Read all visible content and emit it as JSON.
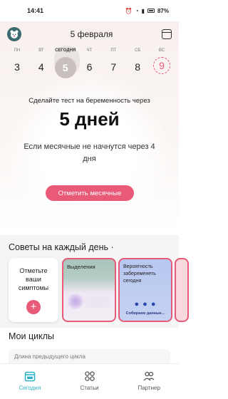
{
  "status_bar": {
    "time": "14:41",
    "battery": "87%"
  },
  "header": {
    "title": "5 февраля"
  },
  "week": [
    {
      "label": "ПН",
      "num": "3"
    },
    {
      "label": "ВТ",
      "num": "4"
    },
    {
      "label": "СЕГОДНЯ",
      "num": "5"
    },
    {
      "label": "ЧТ",
      "num": "6"
    },
    {
      "label": "ПТ",
      "num": "7"
    },
    {
      "label": "СБ",
      "num": "8"
    },
    {
      "label": "ВС",
      "num": "9"
    }
  ],
  "prediction": {
    "label": "Сделайте тест на беременность через",
    "value": "5 дней",
    "sub": "Если месячные не начнутся через 4 дня"
  },
  "mark_button": "Отметить месячные",
  "tips": {
    "title": "Советы на каждый день ·",
    "cards": [
      {
        "text": "Отметьте ваши симптомы"
      },
      {
        "text": "Выделения"
      },
      {
        "text": "Вероятность забеременеть сегодня",
        "footer": "Собираем данные..."
      }
    ]
  },
  "cycles": {
    "title": "Мои циклы",
    "row": "Длина предыдущего цикла"
  },
  "tabbar": [
    {
      "label": "Сегодня",
      "icon": "calendar-icon"
    },
    {
      "label": "Статьи",
      "icon": "grid-icon"
    },
    {
      "label": "Партнер",
      "icon": "partner-icon"
    }
  ],
  "colors": {
    "accent": "#e85a78",
    "active_tab": "#2bb0c4"
  }
}
